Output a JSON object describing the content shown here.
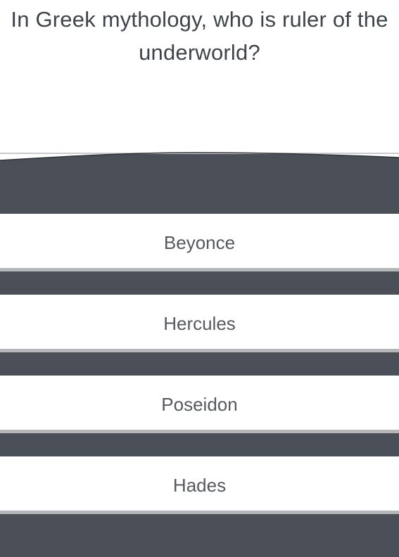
{
  "quiz": {
    "question": "In Greek mythology, who is ruler of the underworld?",
    "answers": [
      {
        "label": "Beyonce"
      },
      {
        "label": "Hercules"
      },
      {
        "label": "Poseidon"
      },
      {
        "label": "Hades"
      }
    ]
  },
  "colors": {
    "background": "#ffffff",
    "panel": "#4b5058",
    "button_shadow": "#b4b6b9",
    "question_text": "#3f444b",
    "answer_text": "#55595f"
  }
}
